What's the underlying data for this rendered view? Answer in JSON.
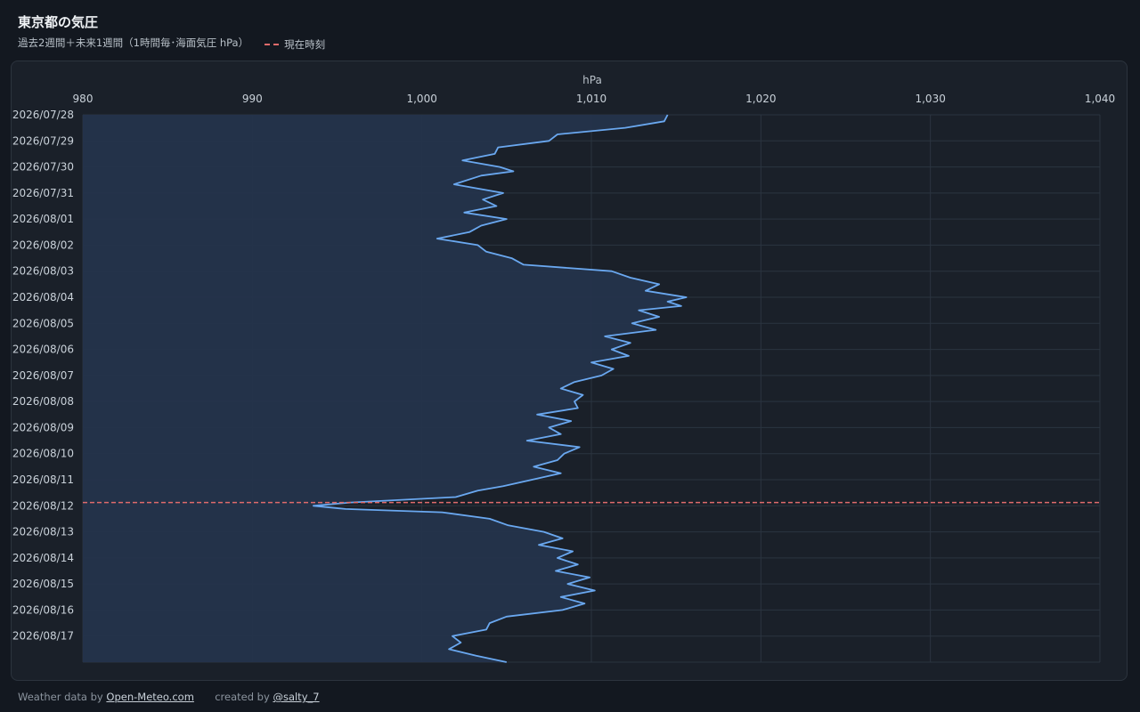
{
  "header": {
    "title": "東京都の気圧",
    "subtitle": "過去2週間＋未来1週間（1時間毎･海面気圧 hPa）",
    "legend_label": "現在時刻"
  },
  "footer": {
    "weather_prefix": "Weather data by",
    "weather_link": "Open-Meteo.com",
    "created_prefix": "created by",
    "created_link": "@salty_7"
  },
  "colors": {
    "line": "#6aa8f0",
    "fill": "#24344b",
    "now_line": "#e06b6b",
    "grid": "#2b3440",
    "tick_text": "#c9d1d9"
  },
  "chart_data": {
    "type": "line",
    "orientation": "vertical-time",
    "xlabel": "hPa",
    "xlim": [
      980,
      1040
    ],
    "x_ticks": [
      "980",
      "990",
      "1,000",
      "1,010",
      "1,020",
      "1,030",
      "1,040"
    ],
    "x_tick_values": [
      980,
      990,
      1000,
      1010,
      1020,
      1030,
      1040
    ],
    "date_labels": [
      "2026/07/28",
      "2026/07/29",
      "2026/07/30",
      "2026/07/31",
      "2026/08/01",
      "2026/08/02",
      "2026/08/03",
      "2026/08/04",
      "2026/08/05",
      "2026/08/06",
      "2026/08/07",
      "2026/08/08",
      "2026/08/09",
      "2026/08/10",
      "2026/08/11",
      "2026/08/12",
      "2026/08/13",
      "2026/08/14",
      "2026/08/15",
      "2026/08/16",
      "2026/08/17"
    ],
    "time_range": [
      "2026/07/28 00:00",
      "2026/08/18 00:00"
    ],
    "now": "2026/08/11 21:00",
    "series": [
      {
        "points": [
          [
            "2026/07/28 00:00",
            1014.5
          ],
          [
            "2026/07/28 06:00",
            1014.3
          ],
          [
            "2026/07/28 12:00",
            1012.0
          ],
          [
            "2026/07/28 18:00",
            1008.0
          ],
          [
            "2026/07/29 00:00",
            1007.5
          ],
          [
            "2026/07/29 06:00",
            1004.5
          ],
          [
            "2026/07/29 12:00",
            1004.3
          ],
          [
            "2026/07/29 18:00",
            1002.4
          ],
          [
            "2026/07/30 00:00",
            1004.6
          ],
          [
            "2026/07/30 04:00",
            1005.4
          ],
          [
            "2026/07/30 08:00",
            1003.5
          ],
          [
            "2026/07/30 16:00",
            1001.9
          ],
          [
            "2026/07/31 00:00",
            1004.8
          ],
          [
            "2026/07/31 06:00",
            1003.6
          ],
          [
            "2026/07/31 12:00",
            1004.4
          ],
          [
            "2026/07/31 18:00",
            1002.5
          ],
          [
            "2026/08/01 00:00",
            1005.0
          ],
          [
            "2026/08/01 06:00",
            1003.5
          ],
          [
            "2026/08/01 12:00",
            1002.8
          ],
          [
            "2026/08/01 18:00",
            1000.9
          ],
          [
            "2026/08/02 00:00",
            1003.3
          ],
          [
            "2026/08/02 06:00",
            1003.8
          ],
          [
            "2026/08/02 12:00",
            1005.3
          ],
          [
            "2026/08/02 18:00",
            1006.0
          ],
          [
            "2026/08/03 00:00",
            1011.2
          ],
          [
            "2026/08/03 06:00",
            1012.3
          ],
          [
            "2026/08/03 12:00",
            1014.0
          ],
          [
            "2026/08/03 18:00",
            1013.2
          ],
          [
            "2026/08/04 00:00",
            1015.6
          ],
          [
            "2026/08/04 04:00",
            1014.5
          ],
          [
            "2026/08/04 08:00",
            1015.3
          ],
          [
            "2026/08/04 12:00",
            1012.8
          ],
          [
            "2026/08/04 18:00",
            1014.0
          ],
          [
            "2026/08/05 00:00",
            1012.4
          ],
          [
            "2026/08/05 06:00",
            1013.8
          ],
          [
            "2026/08/05 12:00",
            1010.8
          ],
          [
            "2026/08/05 18:00",
            1012.3
          ],
          [
            "2026/08/06 00:00",
            1011.2
          ],
          [
            "2026/08/06 06:00",
            1012.2
          ],
          [
            "2026/08/06 12:00",
            1010.0
          ],
          [
            "2026/08/06 18:00",
            1011.3
          ],
          [
            "2026/08/07 00:00",
            1010.6
          ],
          [
            "2026/08/07 06:00",
            1009.0
          ],
          [
            "2026/08/07 12:00",
            1008.2
          ],
          [
            "2026/08/07 18:00",
            1009.5
          ],
          [
            "2026/08/08 00:00",
            1009.0
          ],
          [
            "2026/08/08 06:00",
            1009.2
          ],
          [
            "2026/08/08 12:00",
            1006.8
          ],
          [
            "2026/08/08 18:00",
            1008.8
          ],
          [
            "2026/08/09 00:00",
            1007.5
          ],
          [
            "2026/08/09 06:00",
            1008.2
          ],
          [
            "2026/08/09 12:00",
            1006.2
          ],
          [
            "2026/08/09 18:00",
            1009.3
          ],
          [
            "2026/08/10 00:00",
            1008.4
          ],
          [
            "2026/08/10 06:00",
            1008.0
          ],
          [
            "2026/08/10 12:00",
            1006.6
          ],
          [
            "2026/08/10 18:00",
            1008.2
          ],
          [
            "2026/08/11 00:00",
            1006.5
          ],
          [
            "2026/08/11 06:00",
            1004.8
          ],
          [
            "2026/08/11 10:00",
            1003.3
          ],
          [
            "2026/08/11 16:00",
            1002.0
          ],
          [
            "2026/08/11 21:00",
            995.8
          ],
          [
            "2026/08/12 00:00",
            993.6
          ],
          [
            "2026/08/12 03:00",
            995.5
          ],
          [
            "2026/08/12 06:00",
            1001.2
          ],
          [
            "2026/08/12 12:00",
            1004.0
          ],
          [
            "2026/08/12 18:00",
            1005.1
          ],
          [
            "2026/08/13 00:00",
            1007.2
          ],
          [
            "2026/08/13 06:00",
            1008.3
          ],
          [
            "2026/08/13 12:00",
            1006.9
          ],
          [
            "2026/08/13 18:00",
            1008.9
          ],
          [
            "2026/08/14 00:00",
            1008.0
          ],
          [
            "2026/08/14 06:00",
            1009.2
          ],
          [
            "2026/08/14 12:00",
            1007.9
          ],
          [
            "2026/08/14 18:00",
            1009.9
          ],
          [
            "2026/08/15 00:00",
            1008.6
          ],
          [
            "2026/08/15 06:00",
            1010.2
          ],
          [
            "2026/08/15 12:00",
            1008.2
          ],
          [
            "2026/08/15 18:00",
            1009.6
          ],
          [
            "2026/08/16 00:00",
            1008.3
          ],
          [
            "2026/08/16 06:00",
            1005.0
          ],
          [
            "2026/08/16 12:00",
            1004.0
          ],
          [
            "2026/08/16 18:00",
            1003.8
          ],
          [
            "2026/08/17 00:00",
            1001.8
          ],
          [
            "2026/08/17 06:00",
            1002.3
          ],
          [
            "2026/08/17 12:00",
            1001.6
          ],
          [
            "2026/08/17 18:00",
            1003.2
          ],
          [
            "2026/08/18 00:00",
            1005.0
          ]
        ]
      }
    ],
    "grid": true,
    "legend": "top-left"
  }
}
